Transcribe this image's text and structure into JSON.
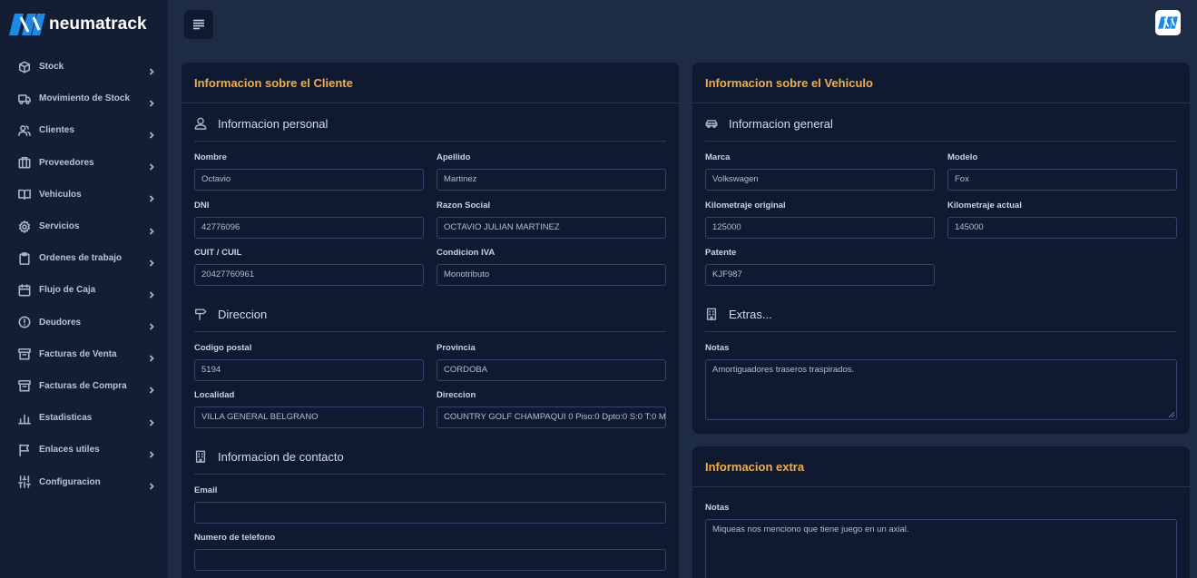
{
  "brand": {
    "name": "neumatrack"
  },
  "sidebar": {
    "items": [
      {
        "label": "Stock",
        "icon": "box-icon"
      },
      {
        "label": "Movimiento de Stock",
        "icon": "truck-icon"
      },
      {
        "label": "Clientes",
        "icon": "users-icon"
      },
      {
        "label": "Proveedores",
        "icon": "building-icon"
      },
      {
        "label": "Vehiculos",
        "icon": "book-icon"
      },
      {
        "label": "Servicios",
        "icon": "gear-icon"
      },
      {
        "label": "Ordenes de trabajo",
        "icon": "clipboard-icon"
      },
      {
        "label": "Flujo de Caja",
        "icon": "calendar-icon"
      },
      {
        "label": "Deudores",
        "icon": "alert-circle-icon"
      },
      {
        "label": "Facturas de Venta",
        "icon": "archive-icon"
      },
      {
        "label": "Facturas de Compra",
        "icon": "archive-icon"
      },
      {
        "label": "Estadisticas",
        "icon": "bar-chart-icon"
      },
      {
        "label": "Enlaces utiles",
        "icon": "flag-icon"
      },
      {
        "label": "Configuracion",
        "icon": "sliders-icon"
      }
    ]
  },
  "cliente": {
    "title": "Informacion sobre el Cliente",
    "personal": {
      "title": "Informacion personal",
      "nombre_label": "Nombre",
      "nombre": "Octavio",
      "apellido_label": "Apellido",
      "apellido": "Martinez",
      "dni_label": "DNI",
      "dni": "42776096",
      "razon_label": "Razon Social",
      "razon": "OCTAVIO JULIAN MARTINEZ",
      "cuit_label": "CUIT / CUIL",
      "cuit": "20427760961",
      "iva_label": "Condicion IVA",
      "iva": "Monotributo"
    },
    "direccion": {
      "title": "Direccion",
      "cp_label": "Codigo postal",
      "cp": "5194",
      "provincia_label": "Provincia",
      "provincia": "CORDOBA",
      "localidad_label": "Localidad",
      "localidad": "VILLA GENERAL BELGRANO",
      "direccion_label": "Direccion",
      "direccion": "COUNTRY GOLF CHAMPAQUI 0 Piso:0 Dpto:0 S:0 T:0 M"
    },
    "contacto": {
      "title": "Informacion de contacto",
      "email_label": "Email",
      "email": "",
      "telefono_label": "Numero de telefono",
      "telefono": ""
    }
  },
  "vehiculo": {
    "title": "Informacion sobre el Vehiculo",
    "general": {
      "title": "Informacion general",
      "marca_label": "Marca",
      "marca": "Volkswagen",
      "modelo_label": "Modelo",
      "modelo": "Fox",
      "km_orig_label": "Kilometraje original",
      "km_orig": "125000",
      "km_act_label": "Kilometraje actual",
      "km_act": "145000",
      "patente_label": "Patente",
      "patente": "KJF987"
    },
    "extras": {
      "title": "Extras...",
      "notas_label": "Notas",
      "notas": "Amortiguadores traseros traspirados."
    }
  },
  "extra": {
    "title": "Informacion extra",
    "notas_label": "Notas",
    "notas": "Miqueas nos menciono que tiene juego en un axial."
  },
  "colors": {
    "accent": "#f0ad4e",
    "background": "#1e2b45",
    "sidebar": "#131d33",
    "card": "#0f1a30",
    "brand_blue": "#1e88e5"
  }
}
